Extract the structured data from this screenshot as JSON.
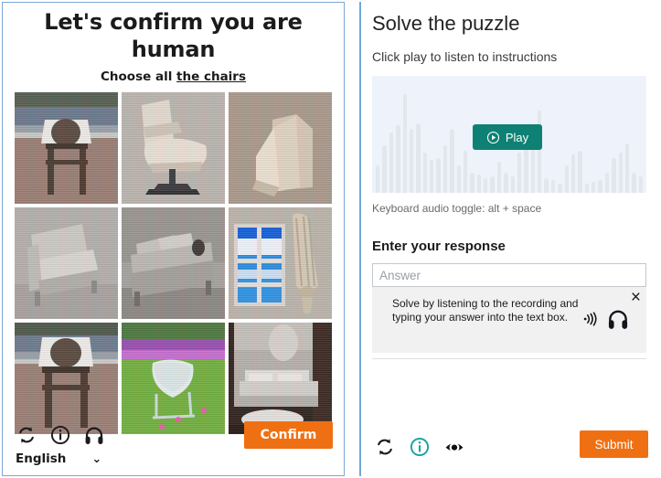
{
  "left_panel": {
    "title": "Let's confirm you are human",
    "instruction_prefix": "Choose all ",
    "instruction_target": "the chairs",
    "tiles": [
      {
        "alt": "white wooden chair on deck with mountain view"
      },
      {
        "alt": "beige leather recliner armchair"
      },
      {
        "alt": "paper bag on textured surface"
      },
      {
        "alt": "grey upholstered armchair"
      },
      {
        "alt": "grey bed with pillows in bedroom"
      },
      {
        "alt": "window with blue sky and beige curtain"
      },
      {
        "alt": "white wooden chair on deck with mountain view"
      },
      {
        "alt": "white garden chair on grass with purple flowers"
      },
      {
        "alt": "bed in dark bedroom with white rug"
      }
    ],
    "icons": [
      {
        "name": "refresh-icon",
        "label": "Refresh challenge"
      },
      {
        "name": "info-icon",
        "label": "Information"
      },
      {
        "name": "headphones-icon",
        "label": "Audio challenge"
      }
    ],
    "language": "English",
    "language_chevron": "⌄",
    "confirm_label": "Confirm"
  },
  "right_panel": {
    "title": "Solve the puzzle",
    "subtitle": "Click play to listen to instructions",
    "play_label": "Play",
    "keyboard_hint": "Keyboard audio toggle: alt + space",
    "response_heading": "Enter your response",
    "answer_value": "",
    "answer_placeholder": "Answer",
    "tooltip": {
      "text": "Solve by listening to the recording and typing your answer into the text box.",
      "close_label": "×",
      "icons": [
        {
          "name": "sound-waves-icon"
        },
        {
          "name": "headphones-icon"
        }
      ]
    },
    "icons": [
      {
        "name": "refresh-icon",
        "label": "Refresh challenge"
      },
      {
        "name": "info-icon",
        "label": "Information"
      },
      {
        "name": "eye-icon",
        "label": "Visual challenge"
      }
    ],
    "submit_label": "Submit"
  },
  "colors": {
    "orange_button": "#ef7012",
    "teal_play": "#0e8174",
    "teal_info": "#17a2a2",
    "panel_border": "#6fa8dc",
    "wave_background": "#eef3fb",
    "wave_bar": "#e2e6ed",
    "tooltip_background": "#f1f1f1"
  },
  "waveform": {
    "bar_heights": [
      30,
      52,
      66,
      74,
      108,
      70,
      76,
      44,
      36,
      38,
      52,
      70,
      30,
      46,
      22,
      20,
      16,
      18,
      34,
      22,
      18,
      44,
      58,
      50,
      90,
      16,
      14,
      10,
      30,
      42,
      46,
      10,
      12,
      14,
      22,
      38,
      44,
      54,
      22,
      18
    ]
  }
}
